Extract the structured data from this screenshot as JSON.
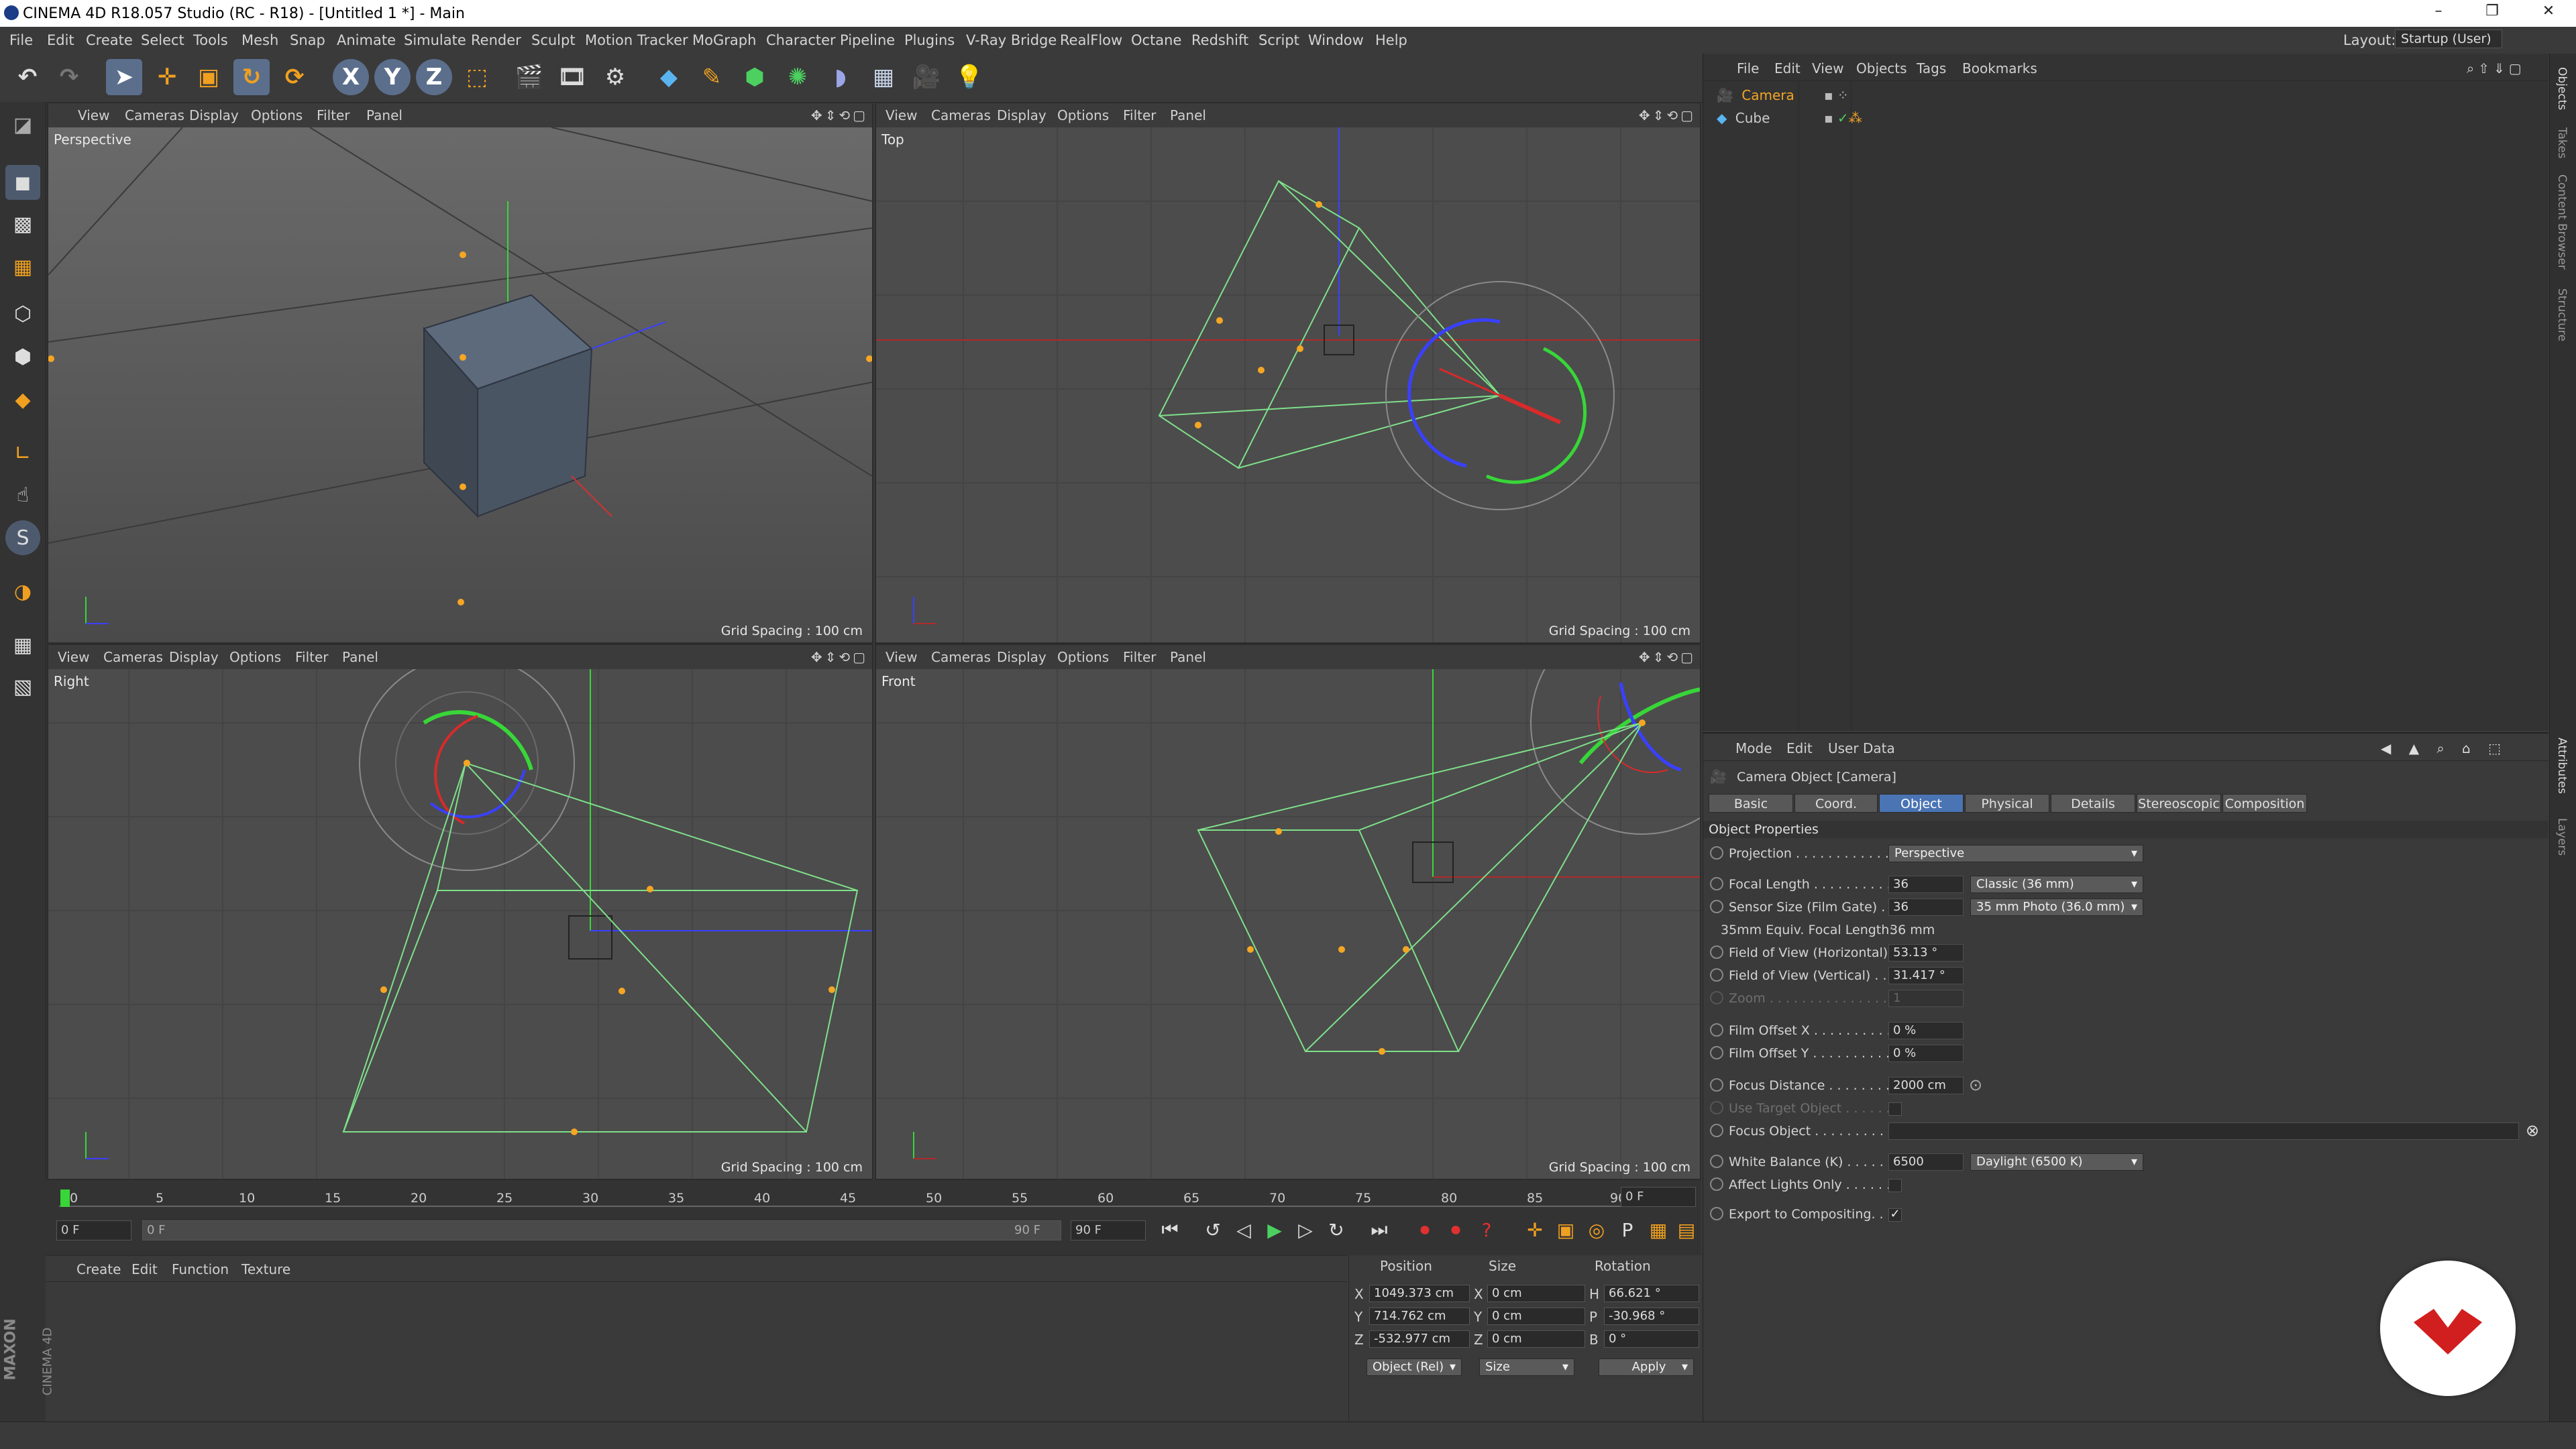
{
  "window": {
    "title": "CINEMA 4D R18.057 Studio (RC - R18) - [Untitled 1 *] - Main"
  },
  "menubar": {
    "items": [
      "File",
      "Edit",
      "Create",
      "Select",
      "Tools",
      "Mesh",
      "Snap",
      "Animate",
      "Simulate",
      "Render",
      "Sculpt",
      "Motion Tracker",
      "MoGraph",
      "Character",
      "Pipeline",
      "Plugins",
      "V-Ray Bridge",
      "RealFlow",
      "Octane",
      "Redshift",
      "Script",
      "Window",
      "Help"
    ],
    "layout_label": "Layout:",
    "layout_value": "Startup (User)"
  },
  "viewports": [
    {
      "menu": [
        "View",
        "Cameras",
        "Display",
        "Options",
        "Filter",
        "Panel"
      ],
      "name": "Perspective",
      "grid": "Grid Spacing : 100 cm"
    },
    {
      "menu": [
        "View",
        "Cameras",
        "Display",
        "Options",
        "Filter",
        "Panel"
      ],
      "name": "Top",
      "grid": "Grid Spacing : 100 cm"
    },
    {
      "menu": [
        "View",
        "Cameras",
        "Display",
        "Options",
        "Filter",
        "Panel"
      ],
      "name": "Right",
      "grid": "Grid Spacing : 100 cm"
    },
    {
      "menu": [
        "View",
        "Cameras",
        "Display",
        "Options",
        "Filter",
        "Panel"
      ],
      "name": "Front",
      "grid": "Grid Spacing : 100 cm"
    }
  ],
  "timeline": {
    "ticks": [
      "0",
      "5",
      "10",
      "15",
      "20",
      "25",
      "30",
      "35",
      "40",
      "45",
      "50",
      "55",
      "60",
      "65",
      "70",
      "75",
      "80",
      "85",
      "90"
    ],
    "current_frame": "0 F",
    "start_field": "0 F",
    "range_start": "0 F",
    "range_end": "90 F",
    "end_field": "90 F"
  },
  "material_manager": {
    "menu": [
      "Create",
      "Edit",
      "Function",
      "Texture"
    ]
  },
  "coordinates": {
    "headers": {
      "position": "Position",
      "size": "Size",
      "rotation": "Rotation"
    },
    "rows": [
      {
        "axis": "X",
        "position": "1049.373 cm",
        "size_axis": "X",
        "size": "0 cm",
        "rot_axis": "H",
        "rotation": "66.621 °"
      },
      {
        "axis": "Y",
        "position": "714.762 cm",
        "size_axis": "Y",
        "size": "0 cm",
        "rot_axis": "P",
        "rotation": "-30.968 °"
      },
      {
        "axis": "Z",
        "position": "-532.977 cm",
        "size_axis": "Z",
        "size": "0 cm",
        "rot_axis": "B",
        "rotation": "0 °"
      }
    ],
    "mode_select": "Object (Rel)",
    "size_select": "Size",
    "apply_label": "Apply"
  },
  "object_manager": {
    "menu": [
      "File",
      "Edit",
      "View",
      "Objects",
      "Tags",
      "Bookmarks"
    ],
    "objects": [
      {
        "name": "Camera",
        "selected": true
      },
      {
        "name": "Cube",
        "selected": false
      }
    ]
  },
  "attribute_manager": {
    "menu": [
      "Mode",
      "Edit",
      "User Data"
    ],
    "object_title": "Camera Object [Camera]",
    "tabs": [
      "Basic",
      "Coord.",
      "Object",
      "Physical",
      "Details",
      "Stereoscopic",
      "Composition"
    ],
    "active_tab": "Object",
    "section": "Object Properties",
    "properties": {
      "projection": {
        "label": "Projection . . . . . . . . . . . . .",
        "value": "Perspective"
      },
      "focal_length": {
        "label": "Focal Length . . . . . . . . . .",
        "value": "36",
        "preset": "Classic (36 mm)"
      },
      "sensor_size": {
        "label": "Sensor Size (Film Gate) . .",
        "value": "36",
        "preset": "35 mm Photo (36.0 mm)"
      },
      "equiv": {
        "label": "35mm Equiv. Focal Length:",
        "value": "36 mm"
      },
      "fov_h": {
        "label": "Field of View (Horizontal)",
        "value": "53.13 °"
      },
      "fov_v": {
        "label": "Field of View (Vertical) . .",
        "value": "31.417 °"
      },
      "zoom": {
        "label": "Zoom . . . . . . . . . . . . . . . .",
        "value": "1"
      },
      "film_offset_x": {
        "label": "Film Offset X . . . . . . . . . .",
        "value": "0 %"
      },
      "film_offset_y": {
        "label": "Film Offset Y . . . . . . . . . .",
        "value": "0 %"
      },
      "focus_distance": {
        "label": "Focus Distance . . . . . . . . .",
        "value": "2000 cm"
      },
      "use_target": {
        "label": "Use Target Object . . . . . ."
      },
      "focus_object": {
        "label": "Focus Object . . . . . . . . . ."
      },
      "white_balance": {
        "label": "White Balance (K) . . . . . . .",
        "value": "6500",
        "preset": "Daylight (6500 K)"
      },
      "affect_lights": {
        "label": "Affect Lights Only . . . . . ."
      },
      "export_comp": {
        "label": "Export to Compositing. . . .",
        "checked": "✓"
      }
    }
  },
  "right_strip_tabs": [
    "Objects",
    "Takes",
    "Content Browser",
    "Structure",
    "Attributes",
    "Layers"
  ],
  "brand": {
    "maxon": "MAXON",
    "cinema": "CINEMA 4D"
  },
  "colors": {
    "accent": "#4a74b4",
    "selection": "#f5a623",
    "camera_wire": "#7fe08a"
  }
}
